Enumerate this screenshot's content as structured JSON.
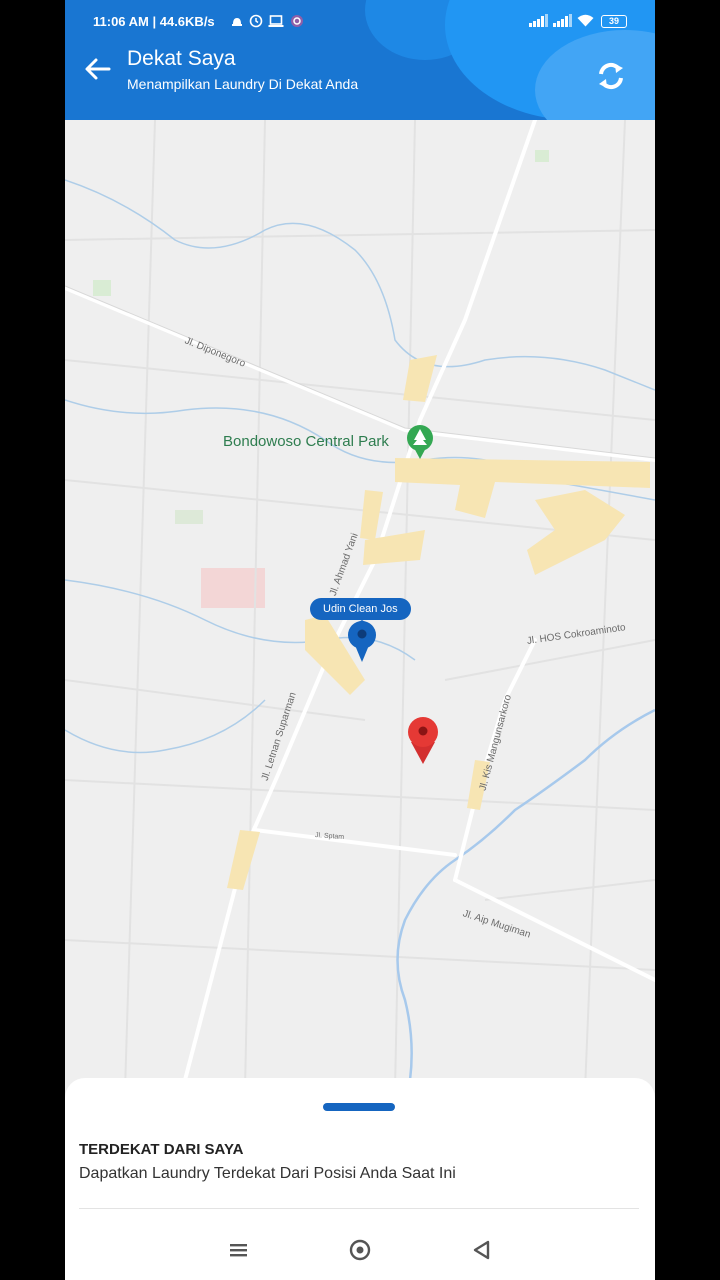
{
  "status_bar": {
    "time_speed": "11:06 AM | 44.6KB/s",
    "battery": "39"
  },
  "header": {
    "title": "Dekat Saya",
    "subtitle": "Menampilkan Laundry Di Dekat Anda"
  },
  "map": {
    "park_name": "Bondowoso Central Park",
    "marker_label": "Udin Clean Jos",
    "streets": {
      "diponegoro": "Jl. Diponegoro",
      "ahmad_yani": "Jl. Ahmad Yani",
      "letnan_suparman": "Jl. Letnan Suparman",
      "hos_cokroaminoto": "Jl. HOS Cokroaminoto",
      "kis_mangunsarkoro": "Jl. Kis Mangunsarkoro",
      "sptam": "Jl. Sptam",
      "aip_mugiman": "Jl. Aip Mugiman"
    },
    "colors": {
      "laundry_marker": "#1565c0",
      "user_marker": "#e53935",
      "park_icon": "#34a853"
    }
  },
  "sheet": {
    "title": "TERDEKAT DARI SAYA",
    "description": "Dapatkan Laundry Terdekat Dari Posisi Anda Saat Ini"
  },
  "nav": {
    "icons": [
      "menu-icon",
      "home-circle-icon",
      "back-triangle-icon"
    ]
  },
  "colors": {
    "header_bg": "#1976d2",
    "accent": "#1565c0"
  }
}
